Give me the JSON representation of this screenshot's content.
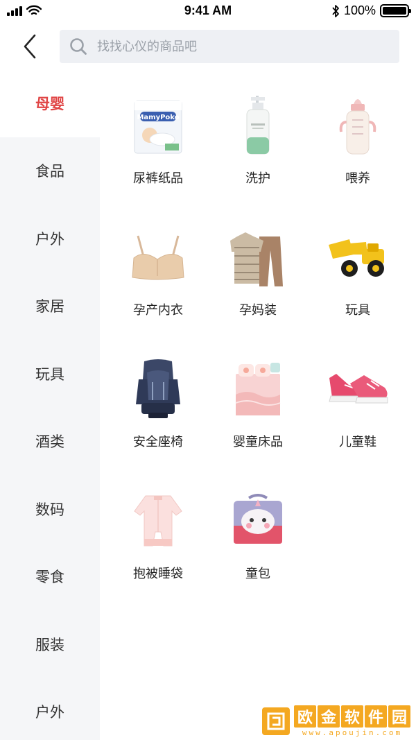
{
  "status_bar": {
    "time": "9:41 AM",
    "battery": "100%",
    "icons": [
      "signal-icon",
      "wifi-icon",
      "bluetooth-icon",
      "battery-icon"
    ]
  },
  "search": {
    "placeholder": "找找心仪的商品吧",
    "value": ""
  },
  "sidebar": {
    "items": [
      {
        "label": "母婴",
        "active": true
      },
      {
        "label": "食品",
        "active": false
      },
      {
        "label": "户外",
        "active": false
      },
      {
        "label": "家居",
        "active": false
      },
      {
        "label": "玩具",
        "active": false
      },
      {
        "label": "酒类",
        "active": false
      },
      {
        "label": "数码",
        "active": false
      },
      {
        "label": "零食",
        "active": false
      },
      {
        "label": "服装",
        "active": false
      },
      {
        "label": "户外",
        "active": false
      }
    ]
  },
  "categories": [
    {
      "label": "尿裤纸品",
      "icon": "diaper-pack-icon"
    },
    {
      "label": "洗护",
      "icon": "lotion-bottle-icon"
    },
    {
      "label": "喂养",
      "icon": "baby-bottle-icon"
    },
    {
      "label": "孕产内衣",
      "icon": "maternity-bra-icon"
    },
    {
      "label": "孕妈装",
      "icon": "maternity-clothes-icon"
    },
    {
      "label": "玩具",
      "icon": "toy-excavator-icon"
    },
    {
      "label": "安全座椅",
      "icon": "car-seat-icon"
    },
    {
      "label": "婴童床品",
      "icon": "crib-bedding-icon"
    },
    {
      "label": "儿童鞋",
      "icon": "kids-shoe-icon"
    },
    {
      "label": "抱被睡袋",
      "icon": "sleeping-bag-icon"
    },
    {
      "label": "童包",
      "icon": "kids-bag-icon"
    }
  ],
  "diaper_brand": "MamyPoko",
  "watermark": {
    "title_chars": [
      "欧",
      "金",
      "软",
      "件",
      "园"
    ],
    "url": "www.apoujin.com"
  },
  "colors": {
    "accent": "#e04545",
    "sidebar_bg": "#f5f6f8",
    "search_bg": "#eef0f4",
    "watermark": "#f4a821"
  }
}
